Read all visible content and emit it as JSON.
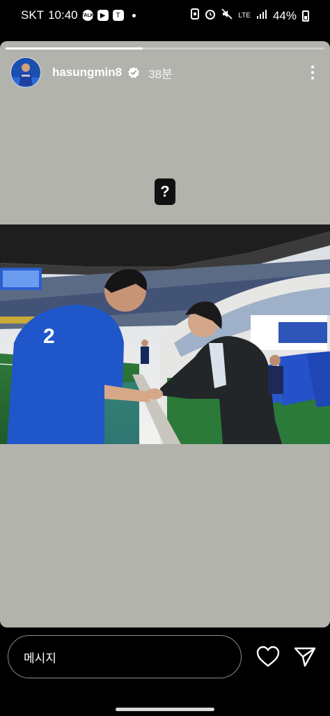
{
  "status_bar": {
    "carrier": "SKT",
    "time": "10:40",
    "talk_label": "TALK",
    "network": "LTE",
    "battery": "44%"
  },
  "story": {
    "progress": 0.43,
    "username": "hasungmin8",
    "time_ago": "38분",
    "question_sticker": "?"
  },
  "reply": {
    "placeholder": "메시지"
  },
  "icons": {
    "more": "more-vertical-icon",
    "verified": "verified-badge-icon",
    "heart": "heart-icon",
    "send": "send-icon"
  }
}
